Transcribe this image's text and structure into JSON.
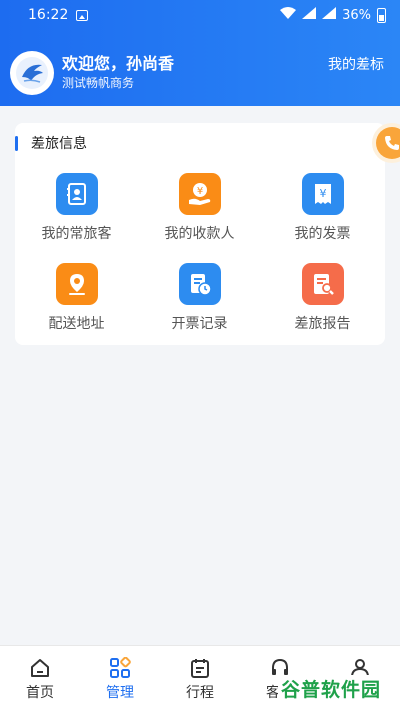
{
  "status_bar": {
    "time": "16:22",
    "battery": "36%",
    "network": "4G"
  },
  "header": {
    "welcome": "欢迎您，孙尚香",
    "company": "测试畅帆商务",
    "my_standard": "我的差标"
  },
  "card": {
    "title": "差旅信息",
    "items": [
      {
        "label": "我的常旅客",
        "icon": "contacts-book-icon",
        "color": "#2d8cf0"
      },
      {
        "label": "我的收款人",
        "icon": "payee-hand-yen-icon",
        "color": "#fa8c16"
      },
      {
        "label": "我的发票",
        "icon": "invoice-yen-icon",
        "color": "#2d8cf0"
      },
      {
        "label": "配送地址",
        "icon": "location-pin-icon",
        "color": "#fa8c16"
      },
      {
        "label": "开票记录",
        "icon": "invoice-record-clock-icon",
        "color": "#2d8cf0"
      },
      {
        "label": "差旅报告",
        "icon": "report-search-icon",
        "color": "#f56c4a"
      }
    ]
  },
  "float_button": {
    "icon": "phone-icon",
    "color": "#f9a53a"
  },
  "bottom_nav": {
    "items": [
      {
        "label": "首页",
        "icon": "home-icon",
        "active": false
      },
      {
        "label": "管理",
        "icon": "grid-icon",
        "active": true
      },
      {
        "label": "行程",
        "icon": "calendar-icon",
        "active": false
      },
      {
        "label": "客服",
        "icon": "headset-icon",
        "active": false
      },
      {
        "label": "我的",
        "icon": "person-icon",
        "active": false
      }
    ]
  },
  "watermark": "谷普软件园",
  "colors": {
    "primary": "#1f6ff0",
    "header_start": "#1d6cf0",
    "header_end": "#2b86f6",
    "background": "#f3f5f8"
  }
}
